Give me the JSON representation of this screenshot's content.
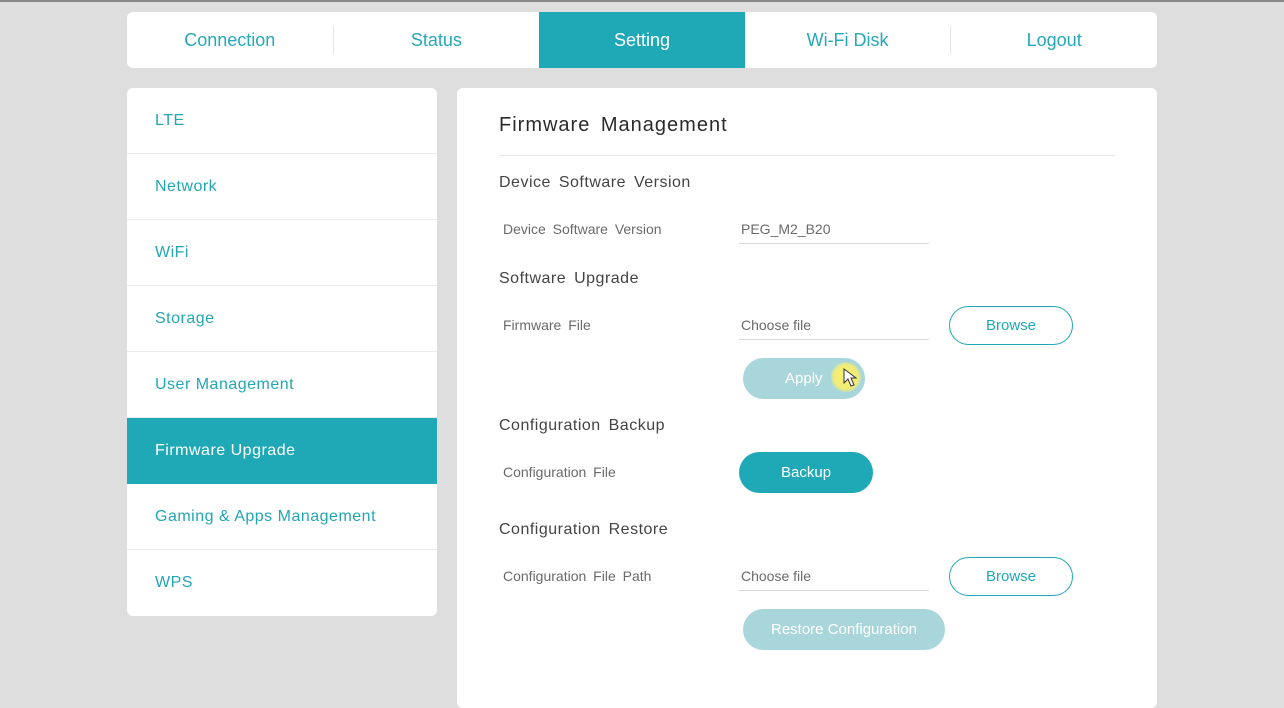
{
  "topnav": {
    "items": [
      {
        "label": "Connection",
        "active": false
      },
      {
        "label": "Status",
        "active": false
      },
      {
        "label": "Setting",
        "active": true
      },
      {
        "label": "Wi-Fi Disk",
        "active": false
      },
      {
        "label": "Logout",
        "active": false
      }
    ]
  },
  "sidebar": {
    "items": [
      {
        "label": "LTE",
        "active": false
      },
      {
        "label": "Network",
        "active": false
      },
      {
        "label": "WiFi",
        "active": false
      },
      {
        "label": "Storage",
        "active": false
      },
      {
        "label": "User Management",
        "active": false
      },
      {
        "label": "Firmware Upgrade",
        "active": true
      },
      {
        "label": "Gaming & Apps Management",
        "active": false
      },
      {
        "label": "WPS",
        "active": false
      }
    ]
  },
  "main": {
    "title": "Firmware Management",
    "device_version": {
      "heading": "Device Software Version",
      "label": "Device Software Version",
      "value": "PEG_M2_B20"
    },
    "software_upgrade": {
      "heading": "Software Upgrade",
      "file_label": "Firmware File",
      "file_placeholder": "Choose file",
      "browse_label": "Browse",
      "apply_label": "Apply"
    },
    "config_backup": {
      "heading": "Configuration Backup",
      "file_label": "Configuration File",
      "backup_label": "Backup"
    },
    "config_restore": {
      "heading": "Configuration Restore",
      "path_label": "Configuration File Path",
      "file_placeholder": "Choose file",
      "browse_label": "Browse",
      "restore_label": "Restore Configuration"
    }
  },
  "colors": {
    "accent": "#1fa8b5",
    "bg": "#dedede",
    "text_muted": "#6a6a6a"
  }
}
